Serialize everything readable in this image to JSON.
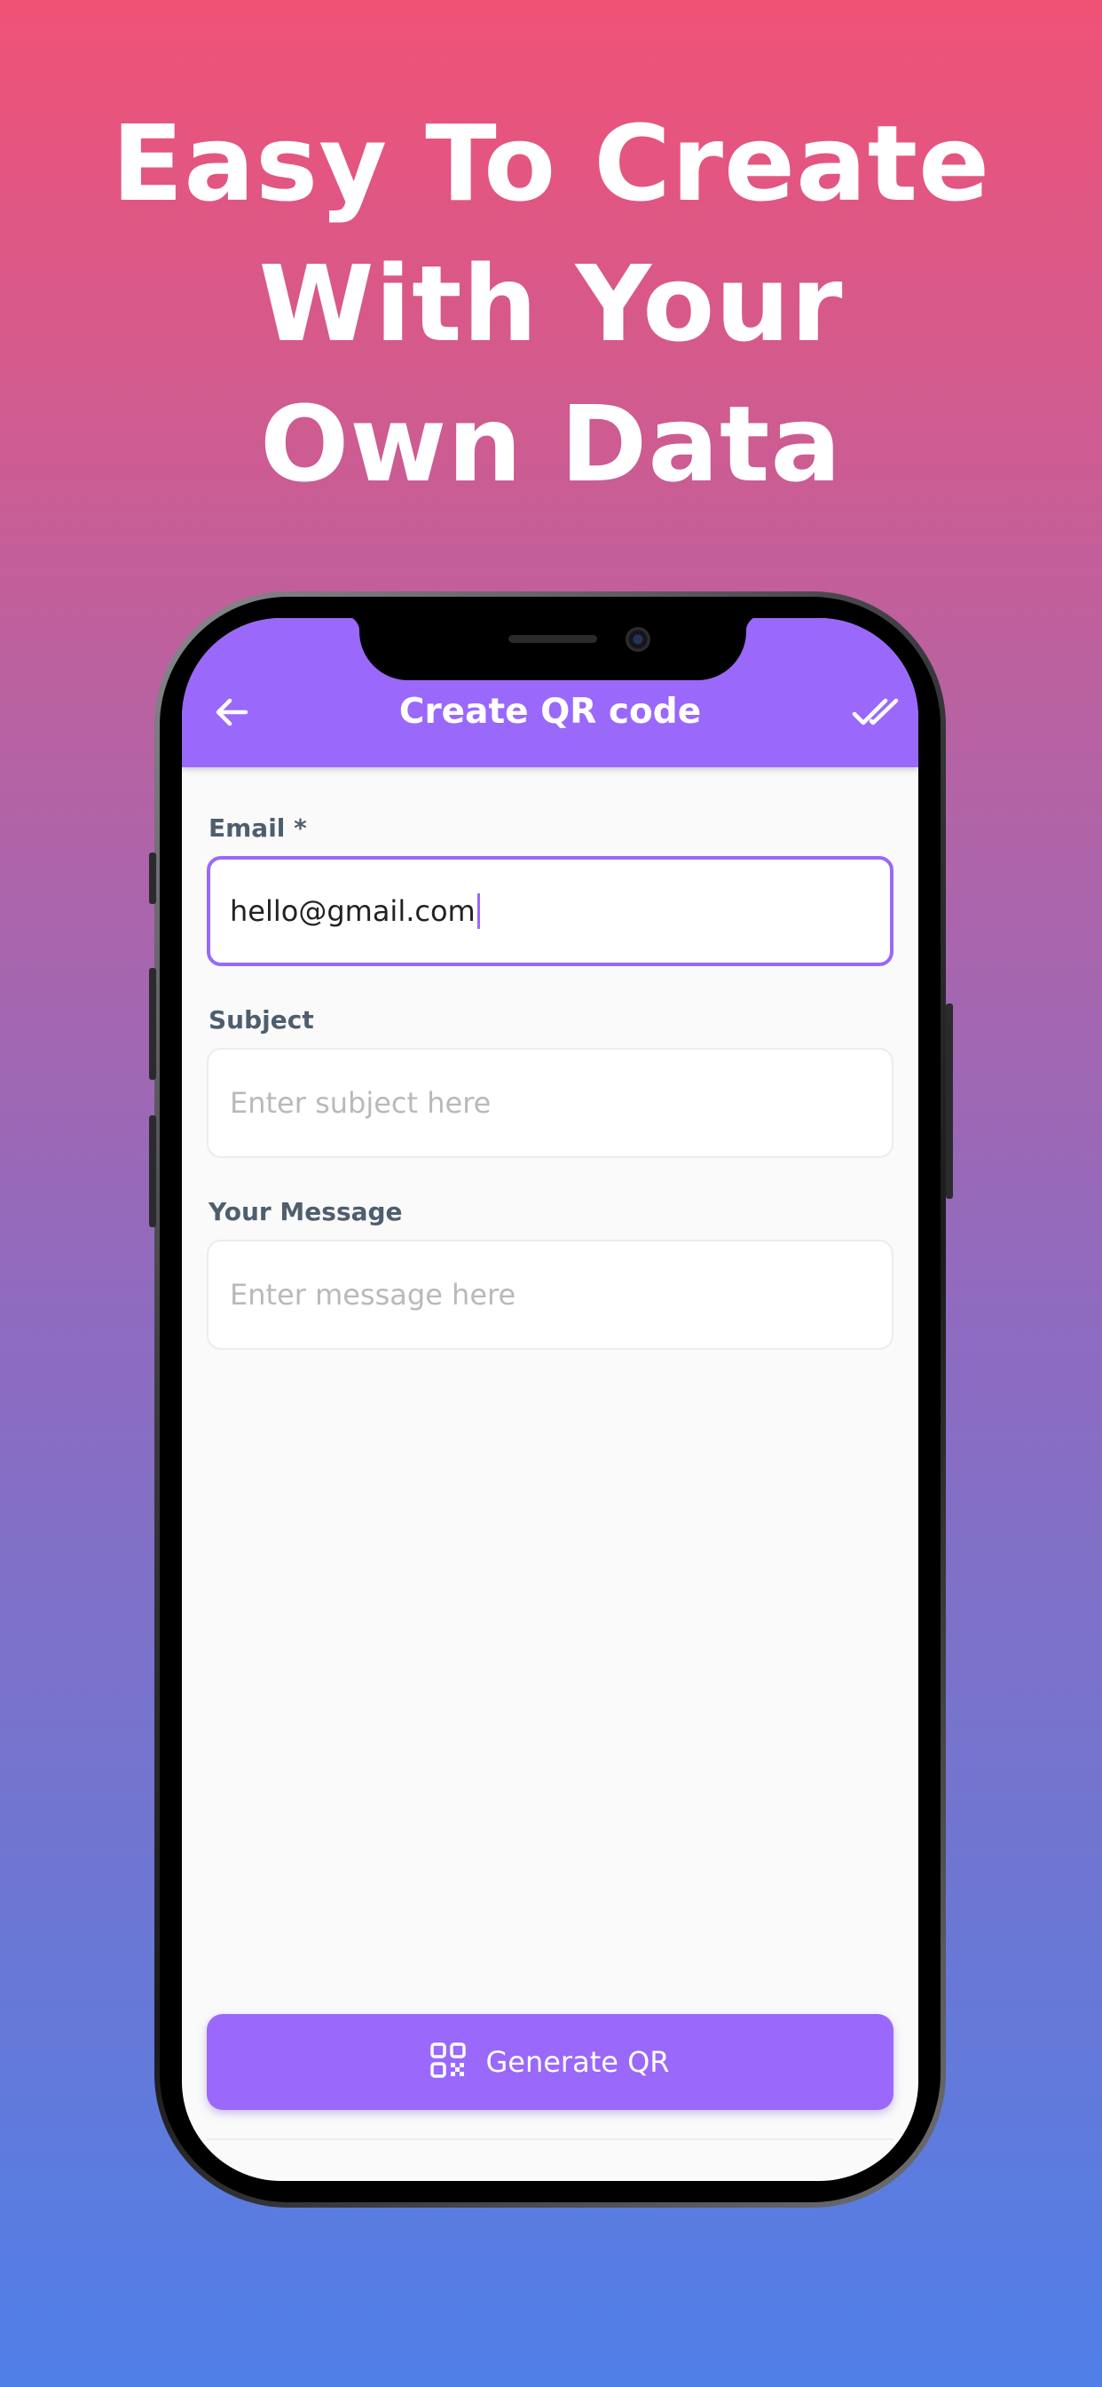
{
  "headline": {
    "line1": "Easy To Create",
    "line2": "With Your",
    "line3": "Own Data"
  },
  "app": {
    "title": "Create QR code",
    "back_icon": "arrow-left-icon",
    "done_icon": "double-check-icon",
    "accent_color": "#9a68fb"
  },
  "form": {
    "email": {
      "label": "Email *",
      "value": "hello@gmail.com"
    },
    "subject": {
      "label": "Subject",
      "placeholder": "Enter subject here"
    },
    "message": {
      "label": "Your Message",
      "placeholder": "Enter message here"
    }
  },
  "generate_button": {
    "label": "Generate QR",
    "icon": "qr-code-icon"
  },
  "colors": {
    "gradient_top": "#f05276",
    "gradient_bottom": "#4f7fe8",
    "label_text": "#4f5e6e",
    "placeholder_text": "#b9b9b9"
  }
}
